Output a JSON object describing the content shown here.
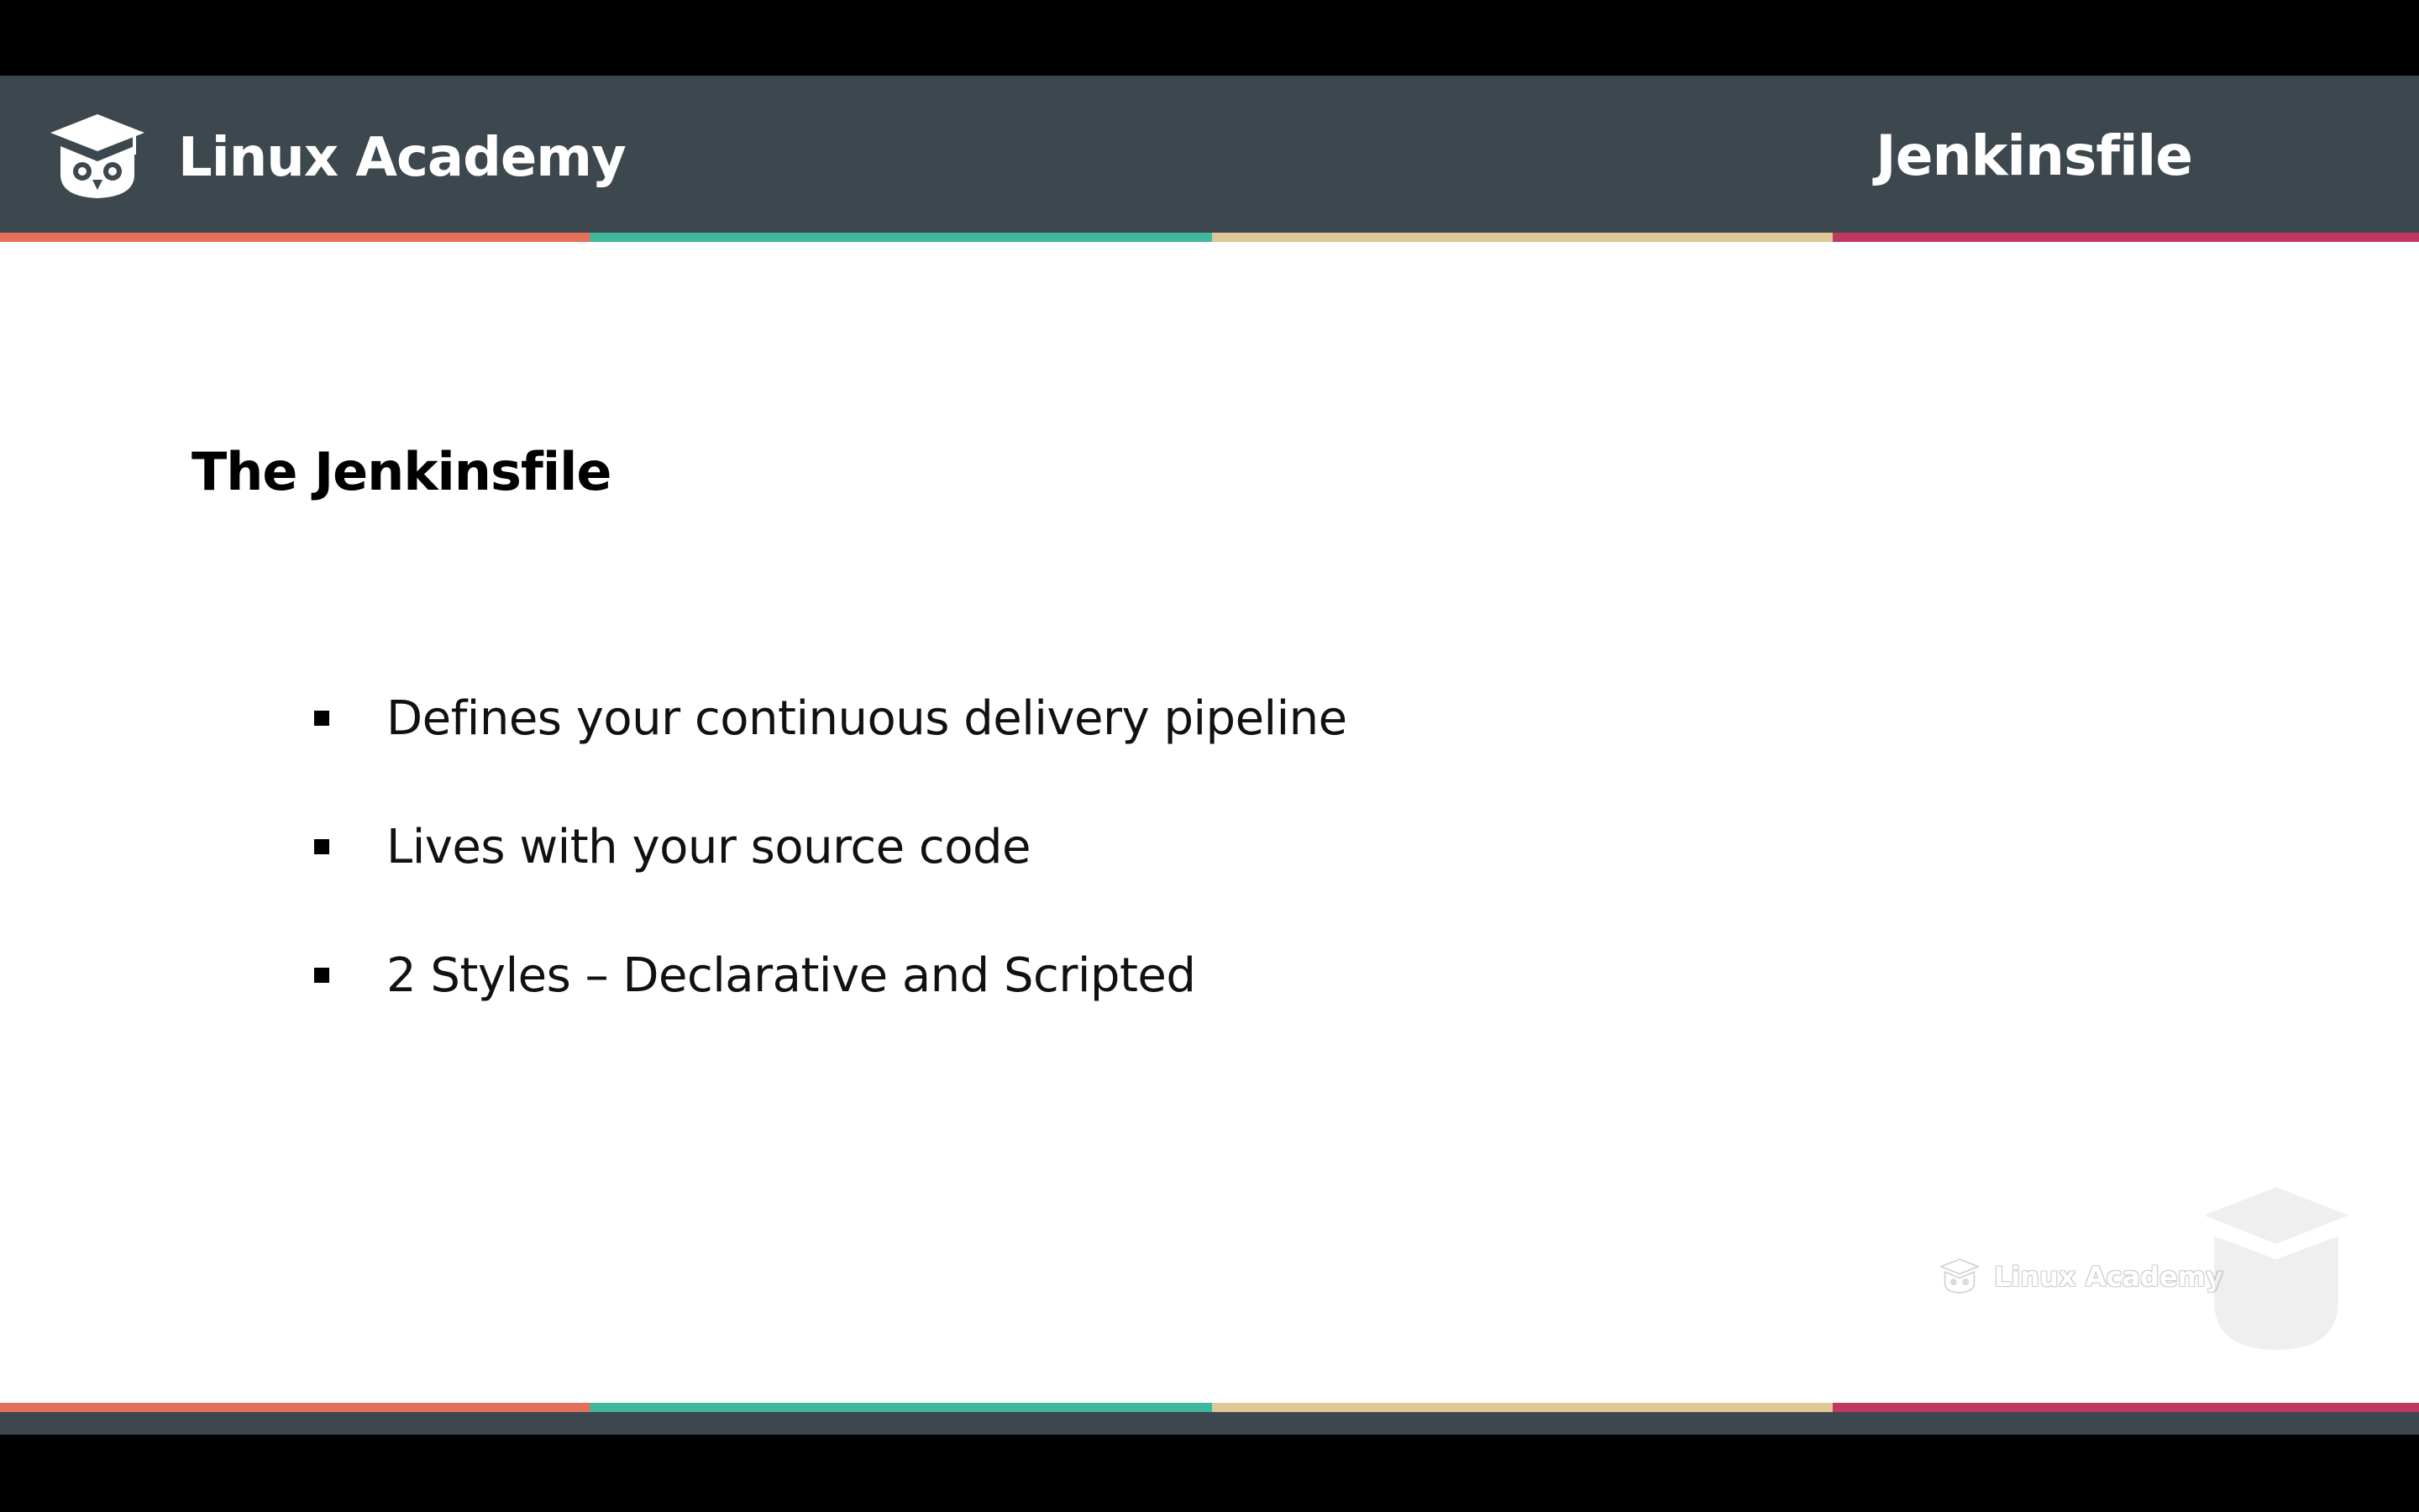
{
  "header": {
    "brand": "Linux Academy",
    "title": "Jenkinsfile",
    "logo_icon": "owl-graduation-cap-icon"
  },
  "colors": {
    "header_bg": "#3c474e",
    "stripe": [
      "#e5705a",
      "#41b79d",
      "#dfc79a",
      "#c0385f"
    ],
    "slide_bg": "#ffffff"
  },
  "slide": {
    "heading": "The Jenkinsfile",
    "bullets": [
      {
        "text": "Defines your continuous delivery pipeline"
      },
      {
        "text": "Lives with your source code"
      },
      {
        "text": "2 Styles – Declarative and Scripted"
      }
    ]
  },
  "watermark": {
    "text": "Linux Academy",
    "icon": "owl-graduation-cap-icon"
  }
}
